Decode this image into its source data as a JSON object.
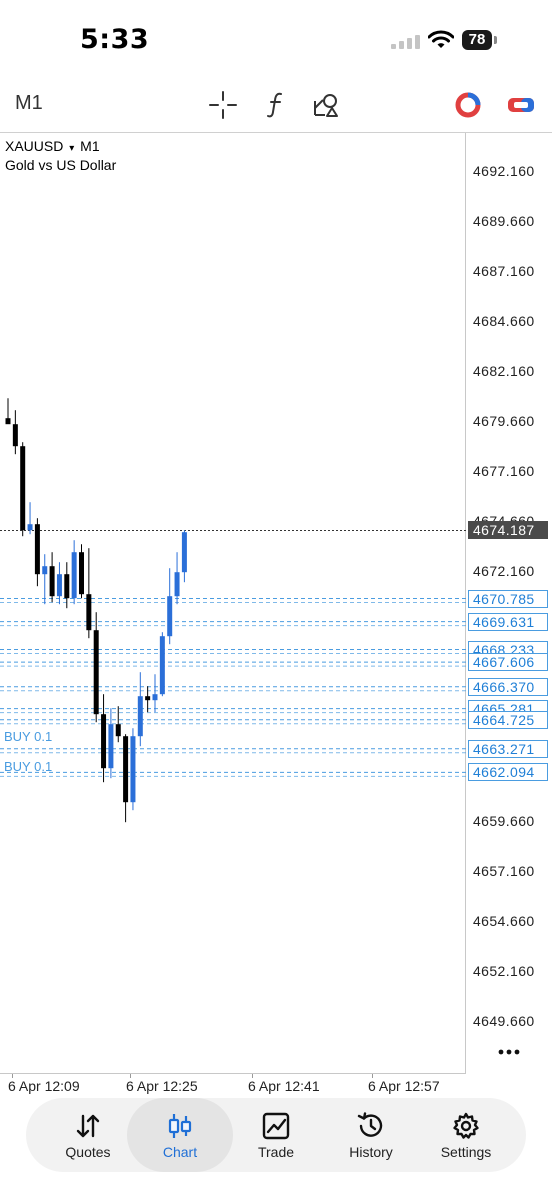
{
  "status_bar": {
    "time": "5:33",
    "battery": "78"
  },
  "toolbar": {
    "timeframe": "M1"
  },
  "chart": {
    "symbol": "XAUUSD",
    "symbol_caret": "▾",
    "timeframe": "M1",
    "description": "Gold vs US Dollar",
    "current_price": "4674.187",
    "order_prices": [
      "4670.785",
      "4669.631",
      "4668.233",
      "4667.606",
      "4666.370",
      "4665.281",
      "4664.725",
      "4663.271",
      "4662.094"
    ],
    "order_labels": [
      "BUY 0.1",
      "BUY 0.1"
    ],
    "colors": {
      "bull": "#2b6fd8",
      "bear": "#000000",
      "order_line": "#4a9ce0",
      "current_price_bg": "#4a4a4a"
    }
  },
  "chart_data": {
    "type": "candlestick",
    "ylim": [
      4647.5,
      4694.5
    ],
    "y_ticks": [
      "4692.160",
      "4689.660",
      "4687.160",
      "4684.660",
      "4682.160",
      "4679.660",
      "4677.160",
      "4674.660",
      "4672.160",
      "4659.660",
      "4657.160",
      "4654.660",
      "4652.160",
      "4649.660"
    ],
    "x_ticks": [
      "6 Apr 12:09",
      "6 Apr 12:25",
      "6 Apr 12:41",
      "6 Apr 12:57"
    ],
    "candles": [
      {
        "o": 4679.8,
        "h": 4680.8,
        "l": 4679.6,
        "c": 4679.5
      },
      {
        "o": 4679.5,
        "h": 4680.2,
        "l": 4678.0,
        "c": 4678.4
      },
      {
        "o": 4678.4,
        "h": 4678.6,
        "l": 4673.9,
        "c": 4674.2
      },
      {
        "o": 4674.2,
        "h": 4675.6,
        "l": 4674.0,
        "c": 4674.5
      },
      {
        "o": 4674.5,
        "h": 4674.8,
        "l": 4671.4,
        "c": 4672.0
      },
      {
        "o": 4672.0,
        "h": 4673.0,
        "l": 4670.5,
        "c": 4672.4
      },
      {
        "o": 4672.4,
        "h": 4673.1,
        "l": 4670.6,
        "c": 4670.9
      },
      {
        "o": 4670.9,
        "h": 4672.6,
        "l": 4670.5,
        "c": 4672.0
      },
      {
        "o": 4672.0,
        "h": 4672.6,
        "l": 4670.3,
        "c": 4670.8
      },
      {
        "o": 4670.8,
        "h": 4673.7,
        "l": 4670.5,
        "c": 4673.1
      },
      {
        "o": 4673.1,
        "h": 4673.5,
        "l": 4670.8,
        "c": 4671.0
      },
      {
        "o": 4671.0,
        "h": 4673.3,
        "l": 4668.8,
        "c": 4669.2
      },
      {
        "o": 4669.2,
        "h": 4670.1,
        "l": 4664.6,
        "c": 4665.0
      },
      {
        "o": 4665.0,
        "h": 4666.0,
        "l": 4661.6,
        "c": 4662.3
      },
      {
        "o": 4662.3,
        "h": 4665.3,
        "l": 4661.8,
        "c": 4664.5
      },
      {
        "o": 4664.5,
        "h": 4665.4,
        "l": 4663.6,
        "c": 4663.9
      },
      {
        "o": 4663.9,
        "h": 4664.0,
        "l": 4659.6,
        "c": 4660.6
      },
      {
        "o": 4660.6,
        "h": 4664.3,
        "l": 4660.2,
        "c": 4663.9
      },
      {
        "o": 4663.9,
        "h": 4667.1,
        "l": 4663.4,
        "c": 4665.9
      },
      {
        "o": 4665.9,
        "h": 4666.4,
        "l": 4665.1,
        "c": 4665.7
      },
      {
        "o": 4665.7,
        "h": 4667.0,
        "l": 4665.1,
        "c": 4666.0
      },
      {
        "o": 4666.0,
        "h": 4669.1,
        "l": 4665.9,
        "c": 4668.9
      },
      {
        "o": 4668.9,
        "h": 4672.3,
        "l": 4668.5,
        "c": 4670.9
      },
      {
        "o": 4670.9,
        "h": 4673.1,
        "l": 4670.5,
        "c": 4672.1
      },
      {
        "o": 4672.1,
        "h": 4674.2,
        "l": 4671.6,
        "c": 4674.1
      }
    ]
  },
  "tabs": [
    {
      "label": "Quotes",
      "icon": "sort-arrows-icon"
    },
    {
      "label": "Chart",
      "icon": "candlestick-icon"
    },
    {
      "label": "Trade",
      "icon": "trend-chart-icon"
    },
    {
      "label": "History",
      "icon": "history-clock-icon"
    },
    {
      "label": "Settings",
      "icon": "gear-icon"
    }
  ]
}
